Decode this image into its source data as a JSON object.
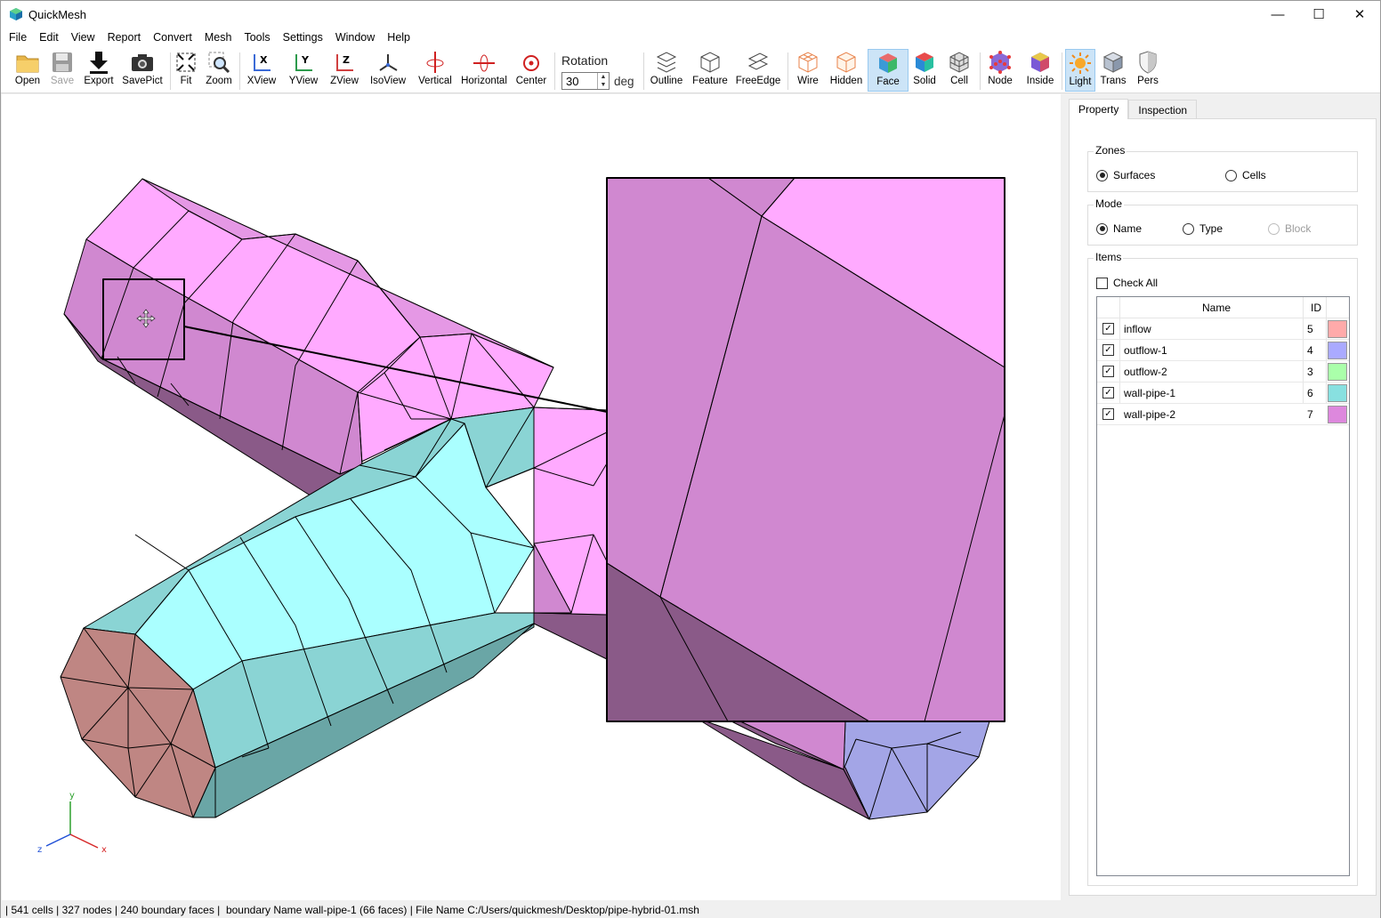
{
  "window": {
    "title": "QuickMesh",
    "minimize": "—",
    "maximize": "☐",
    "close": "✕"
  },
  "menu": [
    "File",
    "Edit",
    "View",
    "Report",
    "Convert",
    "Mesh",
    "Tools",
    "Settings",
    "Window",
    "Help"
  ],
  "toolbar": {
    "open": "Open",
    "save": "Save",
    "export": "Export",
    "savepict": "SavePict",
    "fit": "Fit",
    "zoom": "Zoom",
    "xview": "XView",
    "yview": "YView",
    "zview": "ZView",
    "isoview": "IsoView",
    "vertical": "Vertical",
    "horizontal": "Horizontal",
    "center": "Center",
    "rotation_label": "Rotation",
    "rotation_value": "30",
    "rotation_unit": "deg",
    "outline": "Outline",
    "feature": "Feature",
    "freeedge": "FreeEdge",
    "wire": "Wire",
    "hidden": "Hidden",
    "face": "Face",
    "solid": "Solid",
    "cell": "Cell",
    "node": "Node",
    "inside": "Inside",
    "light": "Light",
    "trans": "Trans",
    "pers": "Pers",
    "active": [
      "Face",
      "Light"
    ]
  },
  "viewport": {
    "triad": {
      "x": "x",
      "y": "y",
      "z": "z"
    },
    "colors": {
      "pink_face": "#ffaaff",
      "pink_side": "#d088d0",
      "pink_dark": "#8a5a88",
      "cyan_face": "#aaffff",
      "cyan_side": "#8ad4d4",
      "cyan_dark": "#6aa6a6",
      "inflow": "#bf8683",
      "outflow1": "#a3a5e6"
    }
  },
  "panel": {
    "tabs": [
      "Property",
      "Inspection"
    ],
    "zones": {
      "title": "Zones",
      "options": [
        "Surfaces",
        "Cells"
      ],
      "selected": "Surfaces"
    },
    "mode": {
      "title": "Mode",
      "options": [
        "Name",
        "Type",
        "Block"
      ],
      "selected": "Name",
      "disabled": [
        "Block"
      ]
    },
    "items": {
      "title": "Items",
      "check_all": "Check All",
      "col_name": "Name",
      "col_id": "ID",
      "rows": [
        {
          "name": "inflow",
          "id": "5",
          "checked": true,
          "color": "#ffaaaa"
        },
        {
          "name": "outflow-1",
          "id": "4",
          "checked": true,
          "color": "#aaaaff"
        },
        {
          "name": "outflow-2",
          "id": "3",
          "checked": true,
          "color": "#aaffaa"
        },
        {
          "name": "wall-pipe-1",
          "id": "6",
          "checked": true,
          "color": "#88e0e0"
        },
        {
          "name": "wall-pipe-2",
          "id": "7",
          "checked": true,
          "color": "#dd88dd"
        }
      ]
    }
  },
  "status": "| 541 cells | 327 nodes | 240 boundary faces |  boundary Name wall-pipe-1 (66 faces) | File Name C:/Users/quickmesh/Desktop/pipe-hybrid-01.msh"
}
